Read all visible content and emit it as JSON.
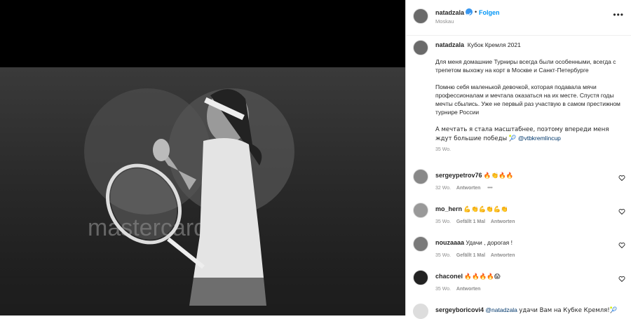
{
  "post": {
    "username": "natadzala",
    "follow_label": "Folgen",
    "location": "Moskau",
    "caption_title": "Кубок Кремля 2021",
    "caption_paragraphs": [
      "Для меня домашние Турниры всегда были особенными, всегда с трепетом выхожу на корт в Москве и Санкт-Петербурге",
      "Помню себя маленькой девочкой, которая подавала мячи профессионалам и мечтала оказаться на их месте. Спустя годы мечты сбылись. Уже не первый раз участвую в самом престижном турнире России",
      "А мечтать я стала масштабнее, поэтому впереди меня ждут большие победы 🎾"
    ],
    "caption_mention": "@vtbkremlincup",
    "caption_time": "35 Wo."
  },
  "comments": [
    {
      "user": "sergeypetrov76",
      "text": "🔥👏🔥🔥",
      "time": "32 Wo.",
      "likes": "",
      "reply": "Antworten",
      "more": "•••"
    },
    {
      "user": "mo_hern",
      "text": "💪👏💪👏💪👏",
      "time": "35 Wo.",
      "likes": "Gefällt 1 Mal",
      "reply": "Antworten"
    },
    {
      "user": "nouzaaaa",
      "text": "Удачи , дорогая !",
      "time": "35 Wo.",
      "likes": "Gefällt 1 Mal",
      "reply": "Antworten"
    },
    {
      "user": "chaconel",
      "text": "🔥🔥🔥🔥😱",
      "time": "35 Wo.",
      "likes": "",
      "reply": "Antworten"
    },
    {
      "user": "sergeyboricovi4",
      "mention": "@natadzala",
      "text": "удачи Вам на Кубке Кремля!🎾",
      "time": "",
      "likes": "",
      "reply": ""
    }
  ],
  "icons": {
    "verified": "verified-badge-icon",
    "more": "more-options-icon",
    "heart": "heart-icon"
  },
  "colors": {
    "accent": "#0095f6",
    "verified": "#3897f0",
    "text": "#262626",
    "muted": "#8e8e8e"
  }
}
